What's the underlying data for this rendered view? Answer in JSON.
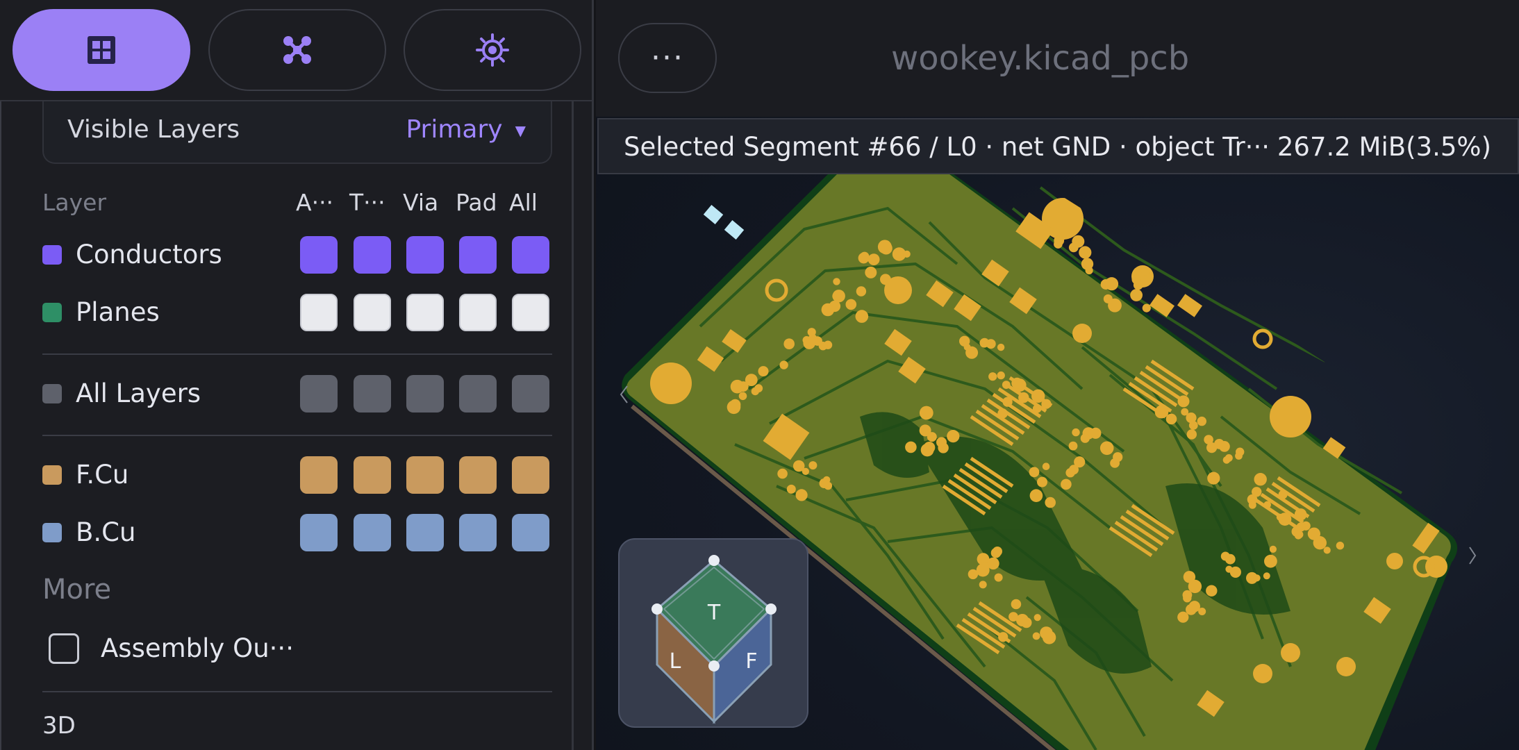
{
  "tabs": [
    {
      "icon": "grid-icon",
      "active": true
    },
    {
      "icon": "drone-icon",
      "active": false
    },
    {
      "icon": "sun-target-icon",
      "active": false
    }
  ],
  "layers_panel": {
    "title": "Visible Layers",
    "preset": "Primary",
    "columns": {
      "layer": "Layer",
      "a": "A···",
      "t": "T···",
      "via": "Via",
      "pad": "Pad",
      "all": "All"
    },
    "rows": [
      {
        "label": "Conductors",
        "color": "#7b5cf5",
        "cell_color": "#7b5cf5"
      },
      {
        "label": "Planes",
        "color": "#2e8f66",
        "cell_color": "#e9eaee"
      },
      {
        "label": "All Layers",
        "color": "#5e616b",
        "cell_color": "#5e616b"
      },
      {
        "label": "F.Cu",
        "color": "#c99a5e",
        "cell_color": "#c99a5e"
      },
      {
        "label": "B.Cu",
        "color": "#7f9cc9",
        "cell_color": "#7f9cc9"
      }
    ],
    "more_label": "More",
    "assembly_label": "Assembly Ou···",
    "assembly_checked": false,
    "section_3d": "3D"
  },
  "viewer": {
    "menu_label": "···",
    "file_title": "wookey.kicad_pcb",
    "selection_status": "Selected Segment #66 / L0 · net GND · object Tr···",
    "memory": "267.2 MiB(3.5%)",
    "cube": {
      "top": "T",
      "left": "L",
      "front": "F"
    }
  },
  "colors": {
    "accent": "#9b80f5",
    "board": "#6a7a2a",
    "copper_pad": "#e0aa35",
    "trace_dark": "#2f5d1c"
  }
}
